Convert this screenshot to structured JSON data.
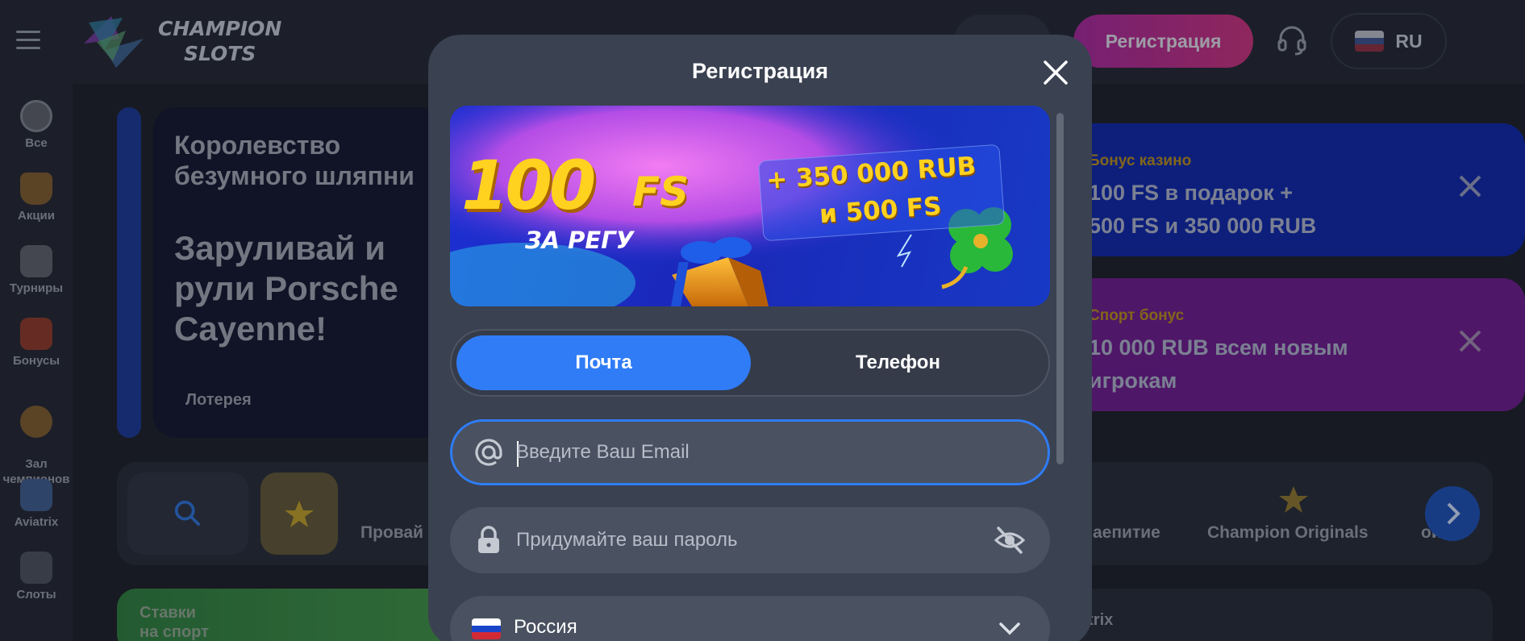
{
  "header": {
    "logo_line1": "CHAMPION",
    "logo_line2": "SLOTS",
    "register_label": "Регистрация",
    "language": "RU"
  },
  "sidebar": {
    "items": [
      {
        "label": "Все",
        "icon": "clock-icon"
      },
      {
        "label": "Акции",
        "icon": "trophy-icon"
      },
      {
        "label": "Турниры",
        "icon": "swords-icon"
      },
      {
        "label": "Бонусы",
        "icon": "gift-icon"
      },
      {
        "label": "Зал\nчемпионов",
        "icon": "medal-icon"
      },
      {
        "label": "Aviatrix",
        "icon": "plane-icon"
      },
      {
        "label": "Слоты",
        "icon": "slot-machine-icon"
      }
    ]
  },
  "promo": {
    "title": "Королевство безумного шляпни",
    "headline": "Заруливай и рули Porsche Cayenne!",
    "tag": "Лотерея"
  },
  "bonuses": [
    {
      "label": "Бонус казино",
      "text_l1": "100 FS в подарок +",
      "text_l2": "500 FS и 350 000 RUB"
    },
    {
      "label": "Спорт бонус",
      "text_l1": "10 000 RUB всем новым",
      "text_l2": "игрокам"
    }
  ],
  "categories": {
    "providers": "Провай",
    "drinking": "аепитие",
    "originals": "Champion Originals",
    "cut": "ой И"
  },
  "bottom": {
    "sport_l1": "Ставки",
    "sport_l2": "на спорт",
    "aviatrix": "atrix"
  },
  "modal": {
    "title": "Регистрация",
    "banner": {
      "big": "100",
      "fs": "FS",
      "za": "ЗА РЕГУ",
      "offer_l1": "+ 350 000 RUB",
      "offer_l2": "и 500 FS"
    },
    "tabs": {
      "email": "Почта",
      "phone": "Телефон"
    },
    "email_placeholder": "Введите Ваш Email",
    "password_placeholder": "Придумайте ваш пароль",
    "country": "Россия"
  },
  "colors": {
    "accent": "#2f7cf6",
    "modal_bg": "#3a4150",
    "field_bg": "#4a5160",
    "page_bg": "#1c2029"
  }
}
